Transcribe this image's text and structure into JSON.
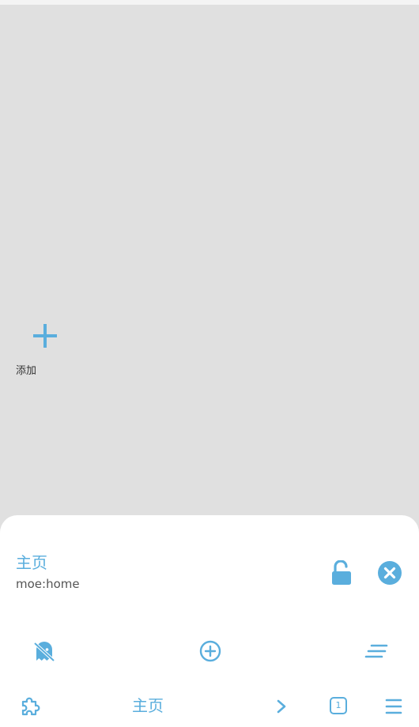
{
  "colors": {
    "accent": "#5aaedd",
    "background": "#e0e0e0",
    "sheet": "#ffffff"
  },
  "home": {
    "add_label": "添加",
    "add_icon": "plus-icon"
  },
  "sheet": {
    "page_title": "主页",
    "page_url": "moe:home",
    "lock_icon": "unlock-icon",
    "close_icon": "close-circle-icon"
  },
  "actions": {
    "icons": [
      "ghost-incognito-icon",
      "add-circle-icon",
      "find-lines-icon"
    ]
  },
  "navbar": {
    "home_label": "主页",
    "tab_count": "1",
    "icons": [
      "puzzle-extension-icon",
      "chevron-right-icon",
      "tabs-icon",
      "menu-icon"
    ]
  }
}
